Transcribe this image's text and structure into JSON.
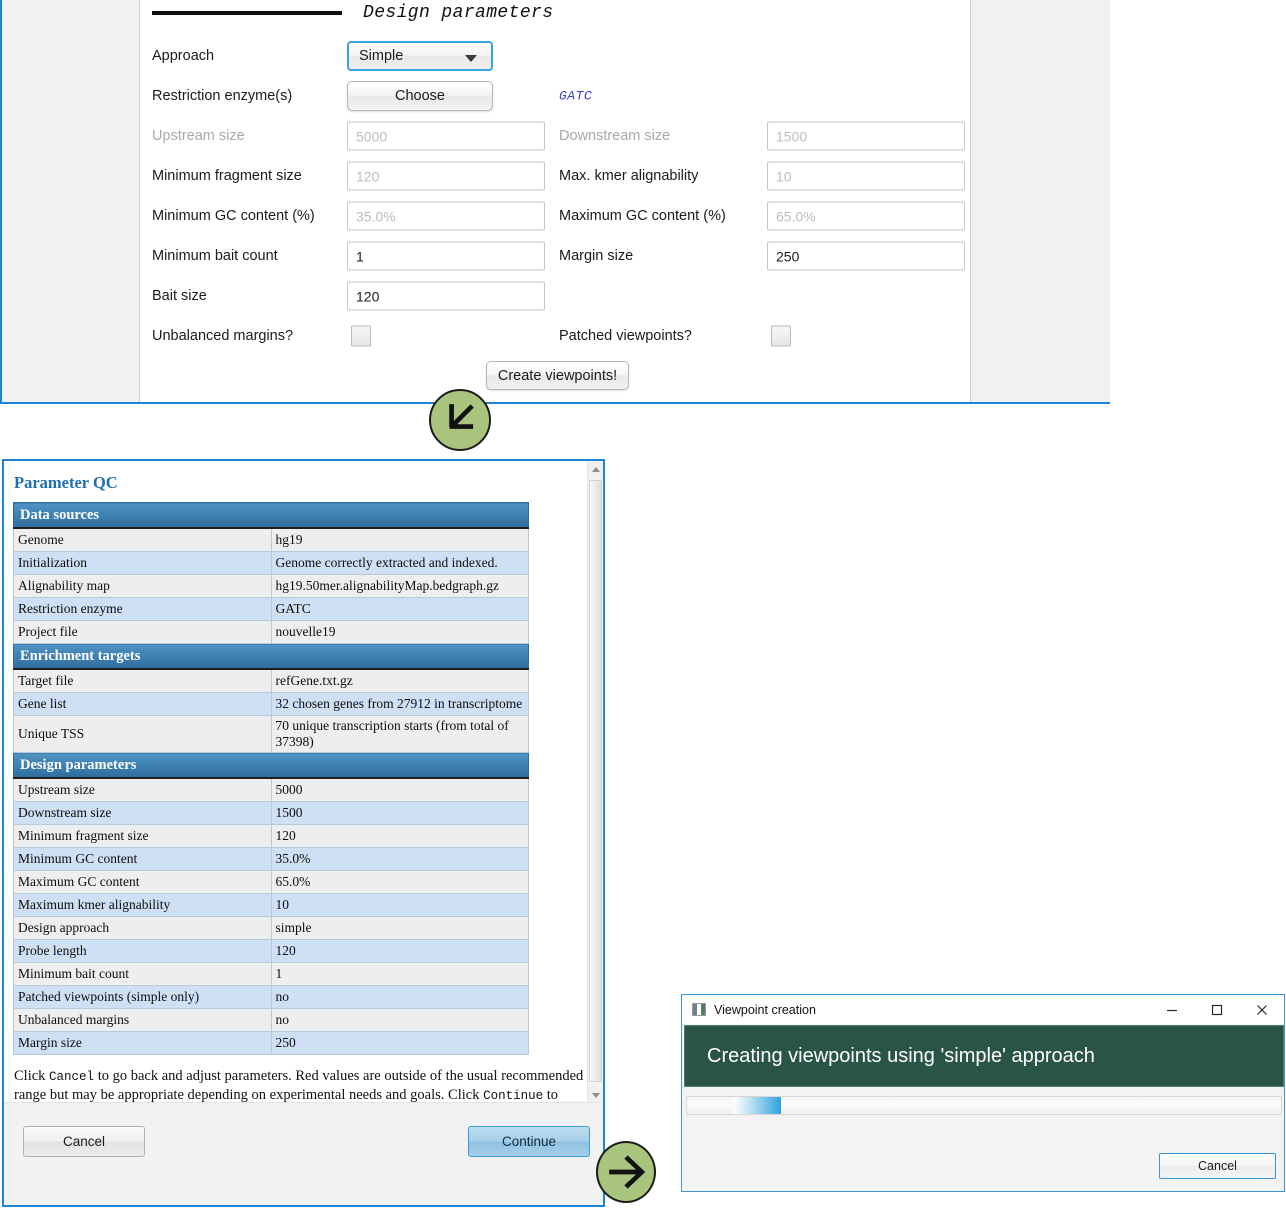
{
  "design_panel": {
    "section_title": "Design parameters",
    "rows": [
      {
        "label": "Approach",
        "control": "combo",
        "value": "Simple"
      },
      {
        "label": "Restriction enzyme(s)",
        "control": "button",
        "value": "Choose",
        "tag": "GATC"
      },
      {
        "label": "Upstream size",
        "control": "input",
        "value": "",
        "placeholder": "5000",
        "disabled": true,
        "label2": "Downstream size",
        "value2": "",
        "placeholder2": "1500",
        "disabled2": true
      },
      {
        "label": "Minimum fragment size",
        "control": "input",
        "value": "",
        "placeholder": "120",
        "label2": "Max. kmer alignability",
        "value2": "",
        "placeholder2": "10"
      },
      {
        "label": "Minimum GC content (%)",
        "control": "input",
        "value": "",
        "placeholder": "35.0%",
        "disabled": true,
        "label2": "Maximum GC content (%)",
        "value2": "",
        "placeholder2": "65.0%",
        "disabled2": true
      },
      {
        "label": "Minimum bait count",
        "control": "input",
        "value": "1",
        "placeholder": "",
        "label2": "Margin size",
        "value2": "250",
        "placeholder2": ""
      },
      {
        "label": "Bait size",
        "control": "input",
        "value": "120",
        "placeholder": ""
      },
      {
        "label": "Unbalanced margins?",
        "control": "checkbox",
        "checked": false,
        "label2": "Patched viewpoints?",
        "checked2": false
      }
    ],
    "labels": {
      "approach": "Approach",
      "restriction_enzymes": "Restriction enzyme(s)",
      "upstream_size": "Upstream size",
      "downstream_size": "Downstream size",
      "minimum_fragment_size": "Minimum fragment size",
      "max_kmer_alignability": "Max. kmer alignability",
      "minimum_gc_content": "Minimum GC content (%)",
      "maximum_gc_content": "Maximum GC content (%)",
      "minimum_bait_count": "Minimum bait count",
      "margin_size": "Margin size",
      "bait_size": "Bait size",
      "unbalanced_margins": "Unbalanced margins?",
      "patched_viewpoints": "Patched viewpoints?"
    },
    "values": {
      "approach": "Simple",
      "choose_button": "Choose",
      "enzyme_tag": "GATC",
      "upstream_size_placeholder": "5000",
      "downstream_size_placeholder": "1500",
      "minimum_fragment_size_placeholder": "120",
      "max_kmer_alignability_placeholder": "10",
      "minimum_gc_content_placeholder": "35.0%",
      "maximum_gc_content_placeholder": "65.0%",
      "minimum_bait_count": "1",
      "margin_size": "250",
      "bait_size": "120"
    },
    "create_button": "Create viewpoints!"
  },
  "qc_window": {
    "heading": "Parameter QC",
    "sections": [
      {
        "title": "Data sources",
        "rows": [
          [
            "Genome",
            "hg19"
          ],
          [
            "Initialization",
            "Genome correctly extracted and indexed."
          ],
          [
            "Alignability map",
            "hg19.50mer.alignabilityMap.bedgraph.gz"
          ],
          [
            "Restriction enzyme",
            "GATC"
          ],
          [
            "Project file",
            "nouvelle19"
          ]
        ]
      },
      {
        "title": "Enrichment targets",
        "rows": [
          [
            "Target file",
            "refGene.txt.gz"
          ],
          [
            "Gene list",
            "32 chosen genes from 27912 in transcriptome"
          ],
          [
            "Unique TSS",
            "70 unique transcription starts (from total of 37398)"
          ]
        ]
      },
      {
        "title": "Design parameters",
        "rows": [
          [
            "Upstream size",
            "5000"
          ],
          [
            "Downstream size",
            "1500"
          ],
          [
            "Minimum fragment size",
            "120"
          ],
          [
            "Minimum GC content",
            "35.0%"
          ],
          [
            "Maximum GC content",
            "65.0%"
          ],
          [
            "Maximum kmer alignability",
            "10"
          ],
          [
            "Design approach",
            "simple"
          ],
          [
            "Probe length",
            "120"
          ],
          [
            "Minimum bait count",
            "1"
          ],
          [
            "Patched viewpoints (simple only)",
            "no"
          ],
          [
            "Unbalanced margins",
            "no"
          ],
          [
            "Margin size",
            "250"
          ]
        ]
      }
    ],
    "note_part1": "Click ",
    "note_code1": "Cancel",
    "note_part2": " to go back and adjust parameters. Red values are outside of the usual recommended range but may be appropriate depending on experimental needs and goals. Click ",
    "note_code2": "Continue",
    "note_part3": " to generate Capture Hi-C probes.",
    "cancel_button": "Cancel",
    "continue_button": "Continue"
  },
  "viewpoint_dialog": {
    "title": "Viewpoint creation",
    "banner_text": "Creating viewpoints using 'simple' approach",
    "progress_percent": 8,
    "cancel_button": "Cancel",
    "minimize_icon": "minimize-icon",
    "maximize_icon": "maximize-icon",
    "close_icon": "close-icon"
  },
  "annotations": {
    "arrow_down_left": "arrow-down-left-icon",
    "arrow_right": "arrow-right-icon",
    "color": "#a9c47c"
  }
}
